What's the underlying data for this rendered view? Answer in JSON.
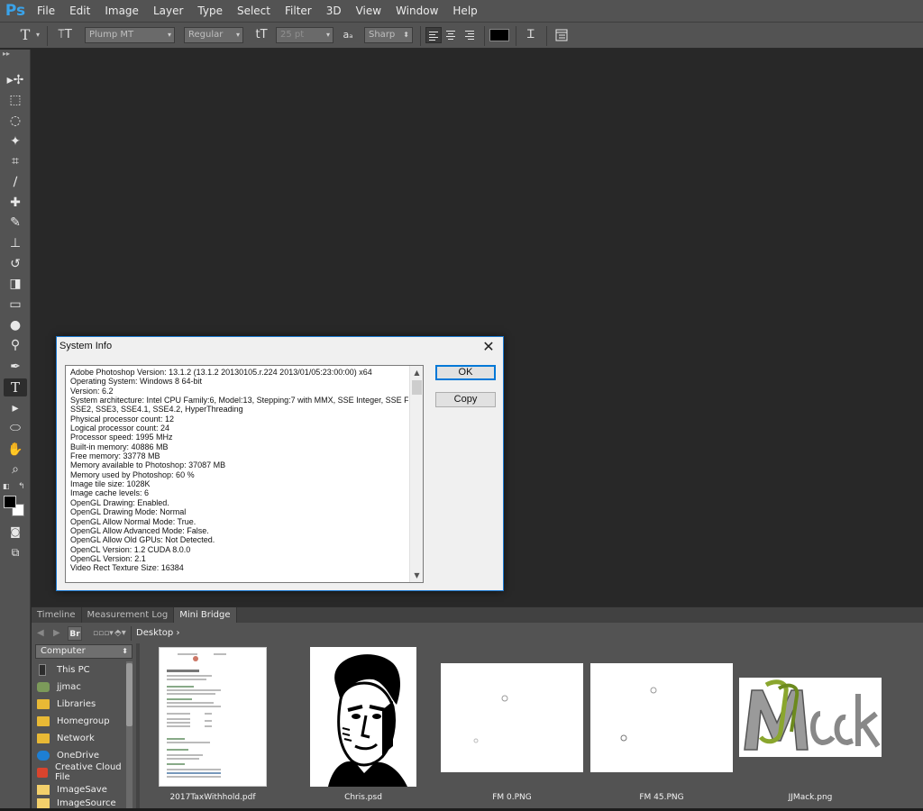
{
  "app": {
    "logo": "Ps",
    "menu": [
      "File",
      "Edit",
      "Image",
      "Layer",
      "Type",
      "Select",
      "Filter",
      "3D",
      "View",
      "Window",
      "Help"
    ]
  },
  "options": {
    "font_family": "Plump MT",
    "font_style": "Regular",
    "font_size": "25 pt",
    "aa_label": "aa",
    "antialias": "Sharp",
    "text_color": "#000000"
  },
  "dialog": {
    "title": "System Info",
    "ok_label": "OK",
    "copy_label": "Copy",
    "lines": [
      "Adobe Photoshop Version: 13.1.2 (13.1.2 20130105.r.224 2013/01/05:23:00:00) x64",
      "Operating System: Windows 8 64-bit",
      "Version: 6.2",
      "System architecture: Intel CPU Family:6, Model:13, Stepping:7 with MMX, SSE Integer, SSE FP,",
      "SSE2, SSE3, SSE4.1, SSE4.2, HyperThreading",
      "Physical processor count: 12",
      "Logical processor count: 24",
      "Processor speed: 1995 MHz",
      "Built-in memory: 40886 MB",
      "Free memory: 33778 MB",
      "Memory available to Photoshop: 37087 MB",
      "Memory used by Photoshop: 60 %",
      "Image tile size: 1028K",
      "Image cache levels: 6",
      "OpenGL Drawing: Enabled.",
      "OpenGL Drawing Mode: Normal",
      "OpenGL Allow Normal Mode: True.",
      "OpenGL Allow Advanced Mode: False.",
      "OpenGL Allow Old GPUs: Not Detected.",
      "OpenCL Version: 1.2 CUDA 8.0.0",
      "OpenGL Version: 2.1",
      "Video Rect Texture Size: 16384"
    ]
  },
  "panel": {
    "tabs": [
      "Timeline",
      "Measurement Log",
      "Mini Bridge"
    ],
    "active_tab": "Mini Bridge",
    "br_badge": "Br",
    "breadcrumb": "Desktop",
    "location": "Computer",
    "nav_items": [
      "This PC",
      "jjmac",
      "Libraries",
      "Homegroup",
      "Network",
      "OneDrive",
      "Creative Cloud File",
      "ImageSave",
      "ImageSource"
    ],
    "files": [
      "2017TaxWithhold.pdf",
      "Chris.psd",
      "FM 0.PNG",
      "FM 45.PNG",
      "JJMack.png"
    ]
  },
  "icons": {
    "logo_color": "#3aa3ea",
    "folder_color": "#e8b935"
  }
}
